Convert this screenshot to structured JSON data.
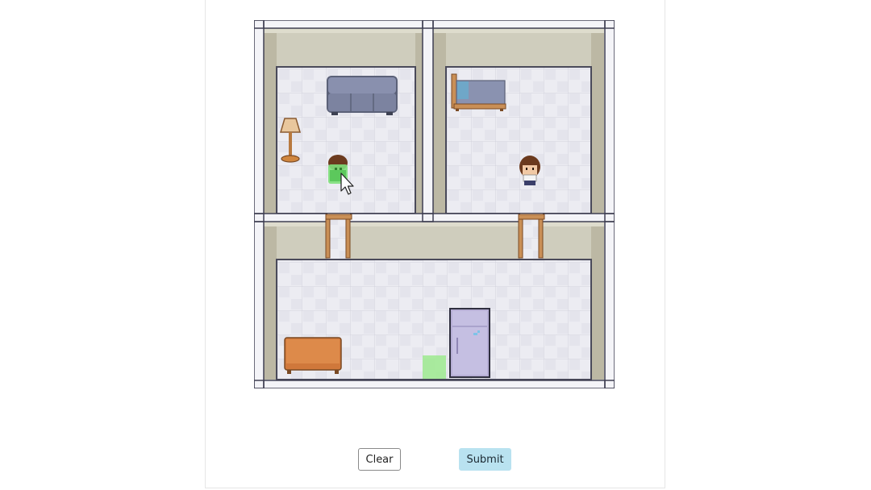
{
  "controls": {
    "clear_label": "Clear",
    "submit_label": "Submit"
  },
  "colors": {
    "frame": "#3f3f52",
    "frame_fill": "#f4f4f8",
    "wall_back": "#cfcdbd",
    "wall_side": "#bcb8a4",
    "floor": "#ececf2",
    "floor_grid": "#d2d2dc",
    "door": "#c98f56",
    "highlight": "#9eea8f",
    "sofa": "#7f86a3",
    "table": "#d0783b",
    "fridge": "#b7afd6"
  },
  "scene": {
    "rooms": [
      "top-left-room",
      "top-right-room",
      "bottom-room"
    ],
    "objects": [
      "sofa",
      "floor-lamp",
      "bed",
      "person",
      "player-highlighted",
      "side-table",
      "refrigerator",
      "target-tile",
      "door-left",
      "door-right"
    ],
    "cursor": "arrow-cursor-icon"
  }
}
